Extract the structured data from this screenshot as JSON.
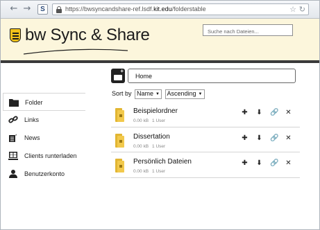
{
  "browser": {
    "url_prefix": "https://bwsyncandshare-ref.lsdf.",
    "url_domain": "kit.edu",
    "url_path": "/folderstable",
    "s_button": "S"
  },
  "header": {
    "brand": "bw Sync & Share",
    "search_placeholder": "Suche nach Dateien..."
  },
  "sidebar": {
    "items": [
      {
        "label": "Folder",
        "icon": "folder-icon",
        "active": true
      },
      {
        "label": "Links",
        "icon": "link-icon",
        "active": false
      },
      {
        "label": "News",
        "icon": "news-icon",
        "active": false
      },
      {
        "label": "Clients runterladen",
        "icon": "clients-icon",
        "active": false
      },
      {
        "label": "Benutzerkonto",
        "icon": "user-icon",
        "active": false
      }
    ]
  },
  "main": {
    "path": "Home",
    "sort_label": "Sort by",
    "sort_field": "Name",
    "sort_order": "Ascending",
    "folders": [
      {
        "name": "Beispielordner",
        "size": "0.00 kB",
        "users": "1 User"
      },
      {
        "name": "Dissertation",
        "size": "0.00 kB",
        "users": "1 User"
      },
      {
        "name": "Persönlich Dateien",
        "size": "0.00 kB",
        "users": "1 User"
      }
    ]
  }
}
